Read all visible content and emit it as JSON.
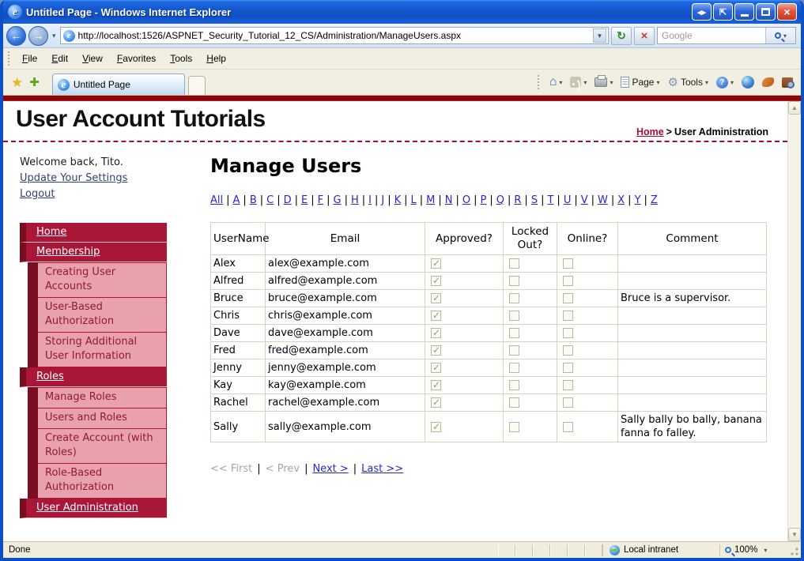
{
  "window": {
    "title": "Untitled Page - Windows Internet Explorer"
  },
  "address_bar": {
    "url": "http://localhost:1526/ASPNET_Security_Tutorial_12_CS/Administration/ManageUsers.aspx",
    "search_placeholder": "Google"
  },
  "menu_bar": {
    "items": [
      "File",
      "Edit",
      "View",
      "Favorites",
      "Tools",
      "Help"
    ]
  },
  "tab_bar": {
    "active_tab": "Untitled Page",
    "page_button": "Page",
    "tools_button": "Tools"
  },
  "site_header": {
    "title": "User Account Tutorials",
    "breadcrumb": {
      "home": "Home",
      "separator": ">",
      "current": "User Administration"
    }
  },
  "sidebar": {
    "welcome": "Welcome back, Tito.",
    "links": [
      "Update Your Settings",
      "Logout"
    ],
    "nav": [
      {
        "label": "Home",
        "level": 1
      },
      {
        "label": "Membership",
        "level": 1
      },
      {
        "label": "Creating User Accounts",
        "level": 2
      },
      {
        "label": "User-Based Authorization",
        "level": 2
      },
      {
        "label": "Storing Additional User Information",
        "level": 2
      },
      {
        "label": "Roles",
        "level": 1
      },
      {
        "label": "Manage Roles",
        "level": 2
      },
      {
        "label": "Users and Roles",
        "level": 2
      },
      {
        "label": "Create Account (with Roles)",
        "level": 2
      },
      {
        "label": "Role-Based Authorization",
        "level": 2
      },
      {
        "label": "User Administration",
        "level": 1
      }
    ]
  },
  "main": {
    "heading": "Manage Users",
    "separator": "|",
    "alphabet": [
      "All",
      "A",
      "B",
      "C",
      "D",
      "E",
      "F",
      "G",
      "H",
      "I",
      "J",
      "K",
      "L",
      "M",
      "N",
      "O",
      "P",
      "Q",
      "R",
      "S",
      "T",
      "U",
      "V",
      "W",
      "X",
      "Y",
      "Z"
    ],
    "table": {
      "headers": [
        "UserName",
        "Email",
        "Approved?",
        "Locked Out?",
        "Online?",
        "Comment"
      ],
      "rows": [
        {
          "username": "Alex",
          "email": "alex@example.com",
          "approved": true,
          "locked_out": false,
          "online": false,
          "comment": ""
        },
        {
          "username": "Alfred",
          "email": "alfred@example.com",
          "approved": true,
          "locked_out": false,
          "online": false,
          "comment": ""
        },
        {
          "username": "Bruce",
          "email": "bruce@example.com",
          "approved": true,
          "locked_out": false,
          "online": false,
          "comment": "Bruce is a supervisor."
        },
        {
          "username": "Chris",
          "email": "chris@example.com",
          "approved": true,
          "locked_out": false,
          "online": false,
          "comment": ""
        },
        {
          "username": "Dave",
          "email": "dave@example.com",
          "approved": true,
          "locked_out": false,
          "online": false,
          "comment": ""
        },
        {
          "username": "Fred",
          "email": "fred@example.com",
          "approved": true,
          "locked_out": false,
          "online": false,
          "comment": ""
        },
        {
          "username": "Jenny",
          "email": "jenny@example.com",
          "approved": true,
          "locked_out": false,
          "online": false,
          "comment": ""
        },
        {
          "username": "Kay",
          "email": "kay@example.com",
          "approved": true,
          "locked_out": false,
          "online": false,
          "comment": ""
        },
        {
          "username": "Rachel",
          "email": "rachel@example.com",
          "approved": true,
          "locked_out": false,
          "online": false,
          "comment": ""
        },
        {
          "username": "Sally",
          "email": "sally@example.com",
          "approved": true,
          "locked_out": false,
          "online": false,
          "comment": "Sally bally bo bally, banana fanna fo falley."
        }
      ]
    },
    "pager": {
      "first": "<< First",
      "prev": "< Prev",
      "next": "Next >",
      "last": "Last >>"
    }
  },
  "status_bar": {
    "status": "Done",
    "zone": "Local intranet",
    "zoom_level": "100%"
  },
  "colors": {
    "accent_crimson": "#A91638",
    "nav_dark_maroon": "#7A0E20",
    "nav_pink": "#E9A2AB",
    "link_blue": "#2727CC",
    "titlebar_blue": "#1557CE",
    "red_divider": "#8E0505"
  }
}
